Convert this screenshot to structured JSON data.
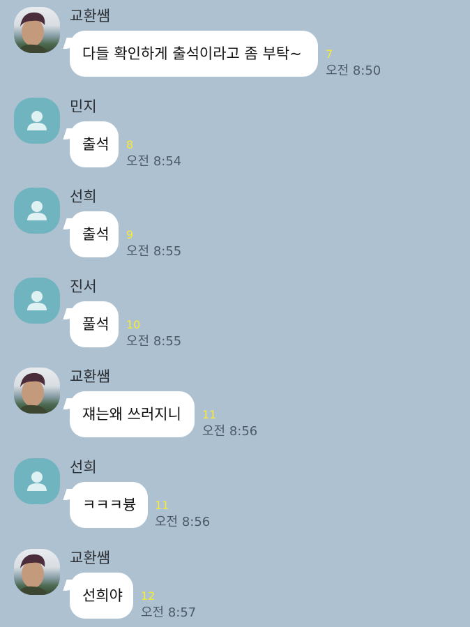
{
  "messages": [
    {
      "sender": "교환쌤",
      "avatar": "teacher-photo-avatar",
      "text": "다들 확인하게 출석이라고 좀 부탁~",
      "unread": "7",
      "time": "오전 8:50"
    },
    {
      "sender": "민지",
      "avatar": "default-person-avatar",
      "text": "출석",
      "unread": "8",
      "time": "오전 8:54"
    },
    {
      "sender": "선희",
      "avatar": "default-person-avatar",
      "text": "출석",
      "unread": "9",
      "time": "오전 8:55"
    },
    {
      "sender": "진서",
      "avatar": "default-person-avatar",
      "text": "풀석",
      "unread": "10",
      "time": "오전 8:55"
    },
    {
      "sender": "교환쌤",
      "avatar": "teacher-photo-avatar",
      "text": "쟤는왜 쓰러지니",
      "unread": "11",
      "time": "오전 8:56"
    },
    {
      "sender": "선희",
      "avatar": "default-person-avatar",
      "text": "ㅋㅋㅋ븅",
      "unread": "11",
      "time": "오전 8:56"
    },
    {
      "sender": "교환쌤",
      "avatar": "teacher-photo-avatar",
      "text": "선희야",
      "unread": "12",
      "time": "오전 8:57"
    }
  ],
  "colors": {
    "background": "#aec1d1",
    "bubble": "#ffffff",
    "unread_count": "#f6ea3b",
    "default_avatar": "#6fb4bf"
  }
}
